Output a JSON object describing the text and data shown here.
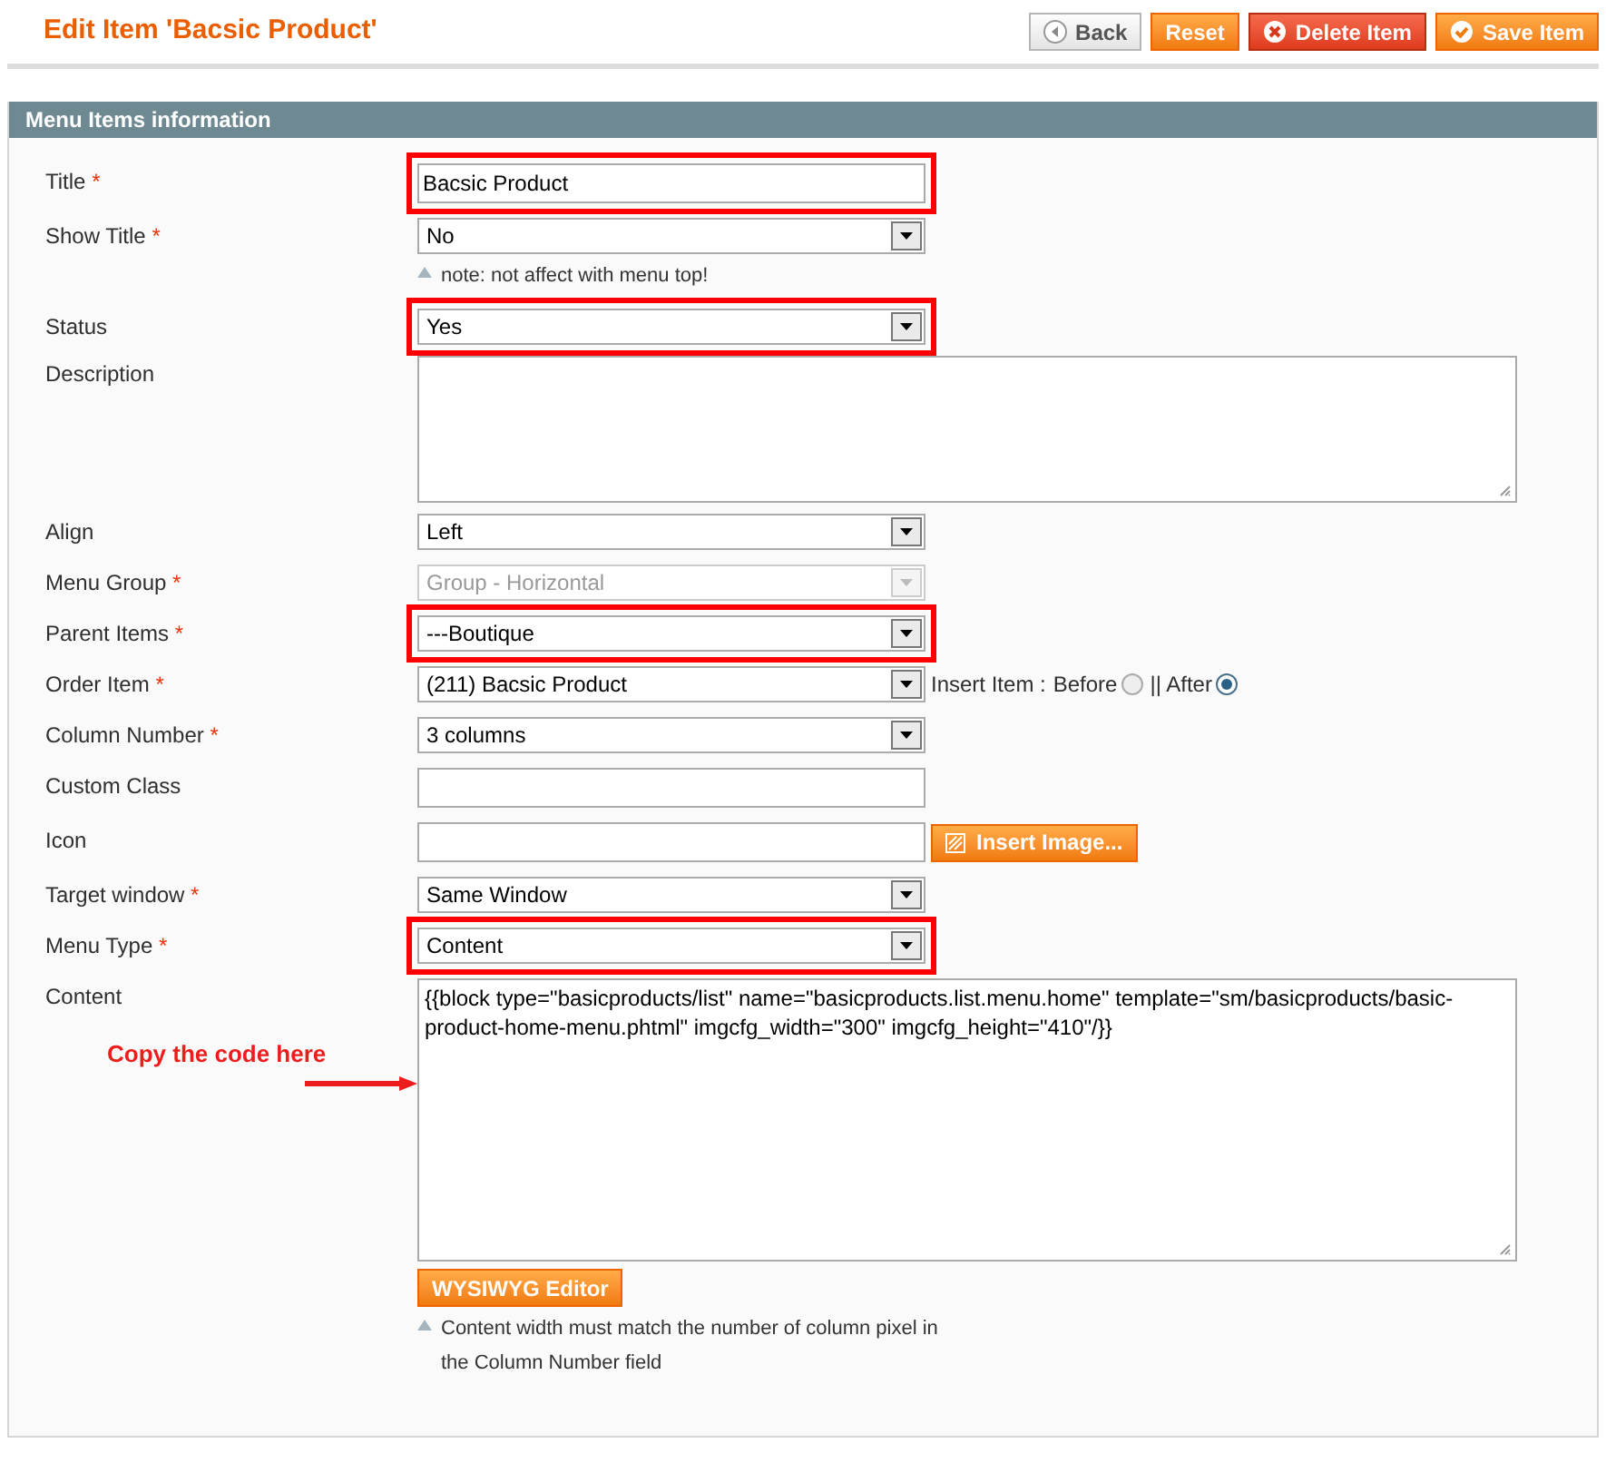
{
  "page_title": "Edit Item 'Bacsic Product'",
  "actions": [
    {
      "label": "Back",
      "kind": "back"
    },
    {
      "label": "Reset",
      "kind": "reset"
    },
    {
      "label": "Delete Item",
      "kind": "delete"
    },
    {
      "label": "Save Item",
      "kind": "save"
    }
  ],
  "section_title": "Menu Items information",
  "fields": [
    {
      "label": "Title",
      "required_mark": "*",
      "kind": "text",
      "value": "Bacsic Product",
      "highlighted": true
    },
    {
      "label": "Show Title",
      "required_mark": "*",
      "kind": "select",
      "value": "No",
      "disabled": false,
      "highlighted": false,
      "note": "note: not affect with menu top!"
    },
    {
      "label": "Status",
      "kind": "select",
      "value": "Yes",
      "disabled": false,
      "highlighted": true
    },
    {
      "label": "Description",
      "kind": "textarea",
      "highlighted": false
    },
    {
      "label": "Align",
      "kind": "select",
      "value": "Left",
      "disabled": false,
      "highlighted": false
    },
    {
      "label": "Menu Group",
      "required_mark": "*",
      "kind": "select",
      "value": "Group - Horizontal",
      "disabled": true,
      "highlighted": false
    },
    {
      "label": "Parent Items",
      "required_mark": "*",
      "kind": "select",
      "value": "---Boutique",
      "disabled": false,
      "highlighted": true
    },
    {
      "label": "Order Item",
      "required_mark": "*",
      "kind": "select",
      "value": "(211) Bacsic Product",
      "disabled": false,
      "highlighted": false,
      "insert": {
        "label": "Insert Item :",
        "options": [
          {
            "label": "Before",
            "selected": false
          },
          {
            "label": "|| After",
            "selected": true
          }
        ]
      }
    },
    {
      "label": "Column Number",
      "required_mark": "*",
      "kind": "select",
      "value": "3 columns",
      "disabled": false,
      "highlighted": false
    },
    {
      "label": "Custom Class",
      "kind": "text",
      "highlighted": false
    },
    {
      "label": "Icon",
      "kind": "text",
      "highlighted": false,
      "button": "Insert Image..."
    },
    {
      "label": "Target window",
      "required_mark": "*",
      "kind": "select",
      "value": "Same Window",
      "disabled": false,
      "highlighted": false
    },
    {
      "label": "Menu Type",
      "required_mark": "*",
      "kind": "select",
      "value": "Content",
      "disabled": false,
      "highlighted": true
    },
    {
      "label": "Content",
      "kind": "textarea",
      "value": "{{block type=\"basicproducts/list\" name=\"basicproducts.list.menu.home\" template=\"sm/basicproducts/basic-product-home-menu.phtml\" imgcfg_width=\"300\"  imgcfg_height=\"410\"/}}",
      "highlighted": false,
      "button": "WYSIWYG Editor",
      "note": "Content width must match the number of column pixel in the Column Number field",
      "annotation": "Copy the code here"
    }
  ]
}
